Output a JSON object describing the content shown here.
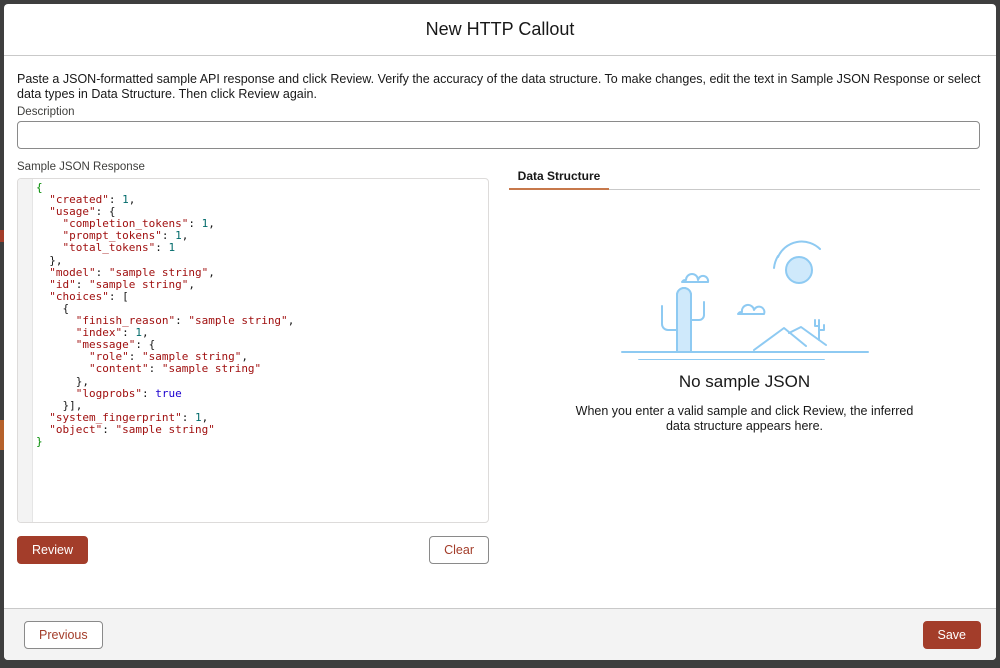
{
  "modal": {
    "title": "New HTTP Callout",
    "intro": "Paste a JSON-formatted sample API response and click Review. Verify the accuracy of the data structure. To make changes, edit the text in Sample JSON Response or select data types in Data Structure. Then click Review again.",
    "description_label": "Description",
    "description_value": "",
    "sample_json_label": "Sample JSON Response",
    "review_label": "Review",
    "clear_label": "Clear",
    "tab_label": "Data Structure",
    "empty_heading": "No sample JSON",
    "empty_text": "When you enter a valid sample and click Review, the inferred data structure appears here.",
    "previous_label": "Previous",
    "save_label": "Save"
  },
  "json_lines": [
    [
      [
        "p",
        "{"
      ]
    ],
    [
      [
        "d",
        "  "
      ],
      [
        "k",
        "\"created\""
      ],
      [
        "d",
        ": "
      ],
      [
        "n",
        "1"
      ],
      [
        "d",
        ","
      ]
    ],
    [
      [
        "d",
        "  "
      ],
      [
        "k",
        "\"usage\""
      ],
      [
        "d",
        ": {"
      ]
    ],
    [
      [
        "d",
        "    "
      ],
      [
        "k",
        "\"completion_tokens\""
      ],
      [
        "d",
        ": "
      ],
      [
        "n",
        "1"
      ],
      [
        "d",
        ","
      ]
    ],
    [
      [
        "d",
        "    "
      ],
      [
        "k",
        "\"prompt_tokens\""
      ],
      [
        "d",
        ": "
      ],
      [
        "n",
        "1"
      ],
      [
        "d",
        ","
      ]
    ],
    [
      [
        "d",
        "    "
      ],
      [
        "k",
        "\"total_tokens\""
      ],
      [
        "d",
        ": "
      ],
      [
        "n",
        "1"
      ]
    ],
    [
      [
        "d",
        "  },"
      ]
    ],
    [
      [
        "d",
        "  "
      ],
      [
        "k",
        "\"model\""
      ],
      [
        "d",
        ": "
      ],
      [
        "s",
        "\"sample string\""
      ],
      [
        "d",
        ","
      ]
    ],
    [
      [
        "d",
        "  "
      ],
      [
        "k",
        "\"id\""
      ],
      [
        "d",
        ": "
      ],
      [
        "s",
        "\"sample string\""
      ],
      [
        "d",
        ","
      ]
    ],
    [
      [
        "d",
        "  "
      ],
      [
        "k",
        "\"choices\""
      ],
      [
        "d",
        ": ["
      ]
    ],
    [
      [
        "d",
        "    {"
      ]
    ],
    [
      [
        "d",
        "      "
      ],
      [
        "k",
        "\"finish_reason\""
      ],
      [
        "d",
        ": "
      ],
      [
        "s",
        "\"sample string\""
      ],
      [
        "d",
        ","
      ]
    ],
    [
      [
        "d",
        "      "
      ],
      [
        "k",
        "\"index\""
      ],
      [
        "d",
        ": "
      ],
      [
        "n",
        "1"
      ],
      [
        "d",
        ","
      ]
    ],
    [
      [
        "d",
        "      "
      ],
      [
        "k",
        "\"message\""
      ],
      [
        "d",
        ": {"
      ]
    ],
    [
      [
        "d",
        "        "
      ],
      [
        "k",
        "\"role\""
      ],
      [
        "d",
        ": "
      ],
      [
        "s",
        "\"sample string\""
      ],
      [
        "d",
        ","
      ]
    ],
    [
      [
        "d",
        "        "
      ],
      [
        "k",
        "\"content\""
      ],
      [
        "d",
        ": "
      ],
      [
        "s",
        "\"sample string\""
      ]
    ],
    [
      [
        "d",
        "      },"
      ]
    ],
    [
      [
        "d",
        "      "
      ],
      [
        "k",
        "\"logprobs\""
      ],
      [
        "d",
        ": "
      ],
      [
        "b",
        "true"
      ]
    ],
    [
      [
        "d",
        "    }],"
      ]
    ],
    [
      [
        "d",
        "  "
      ],
      [
        "k",
        "\"system_fingerprint\""
      ],
      [
        "d",
        ": "
      ],
      [
        "n",
        "1"
      ],
      [
        "d",
        ","
      ]
    ],
    [
      [
        "d",
        "  "
      ],
      [
        "k",
        "\"object\""
      ],
      [
        "d",
        ": "
      ],
      [
        "s",
        "\"sample string\""
      ]
    ],
    [
      [
        "p",
        "}"
      ]
    ]
  ],
  "colors": {
    "brand": "#a33d2a",
    "tab_underline": "#c7784b",
    "illustration_blue": "#8ecaf2"
  },
  "icons": {
    "empty_state": "desert-cactus-illustration"
  }
}
